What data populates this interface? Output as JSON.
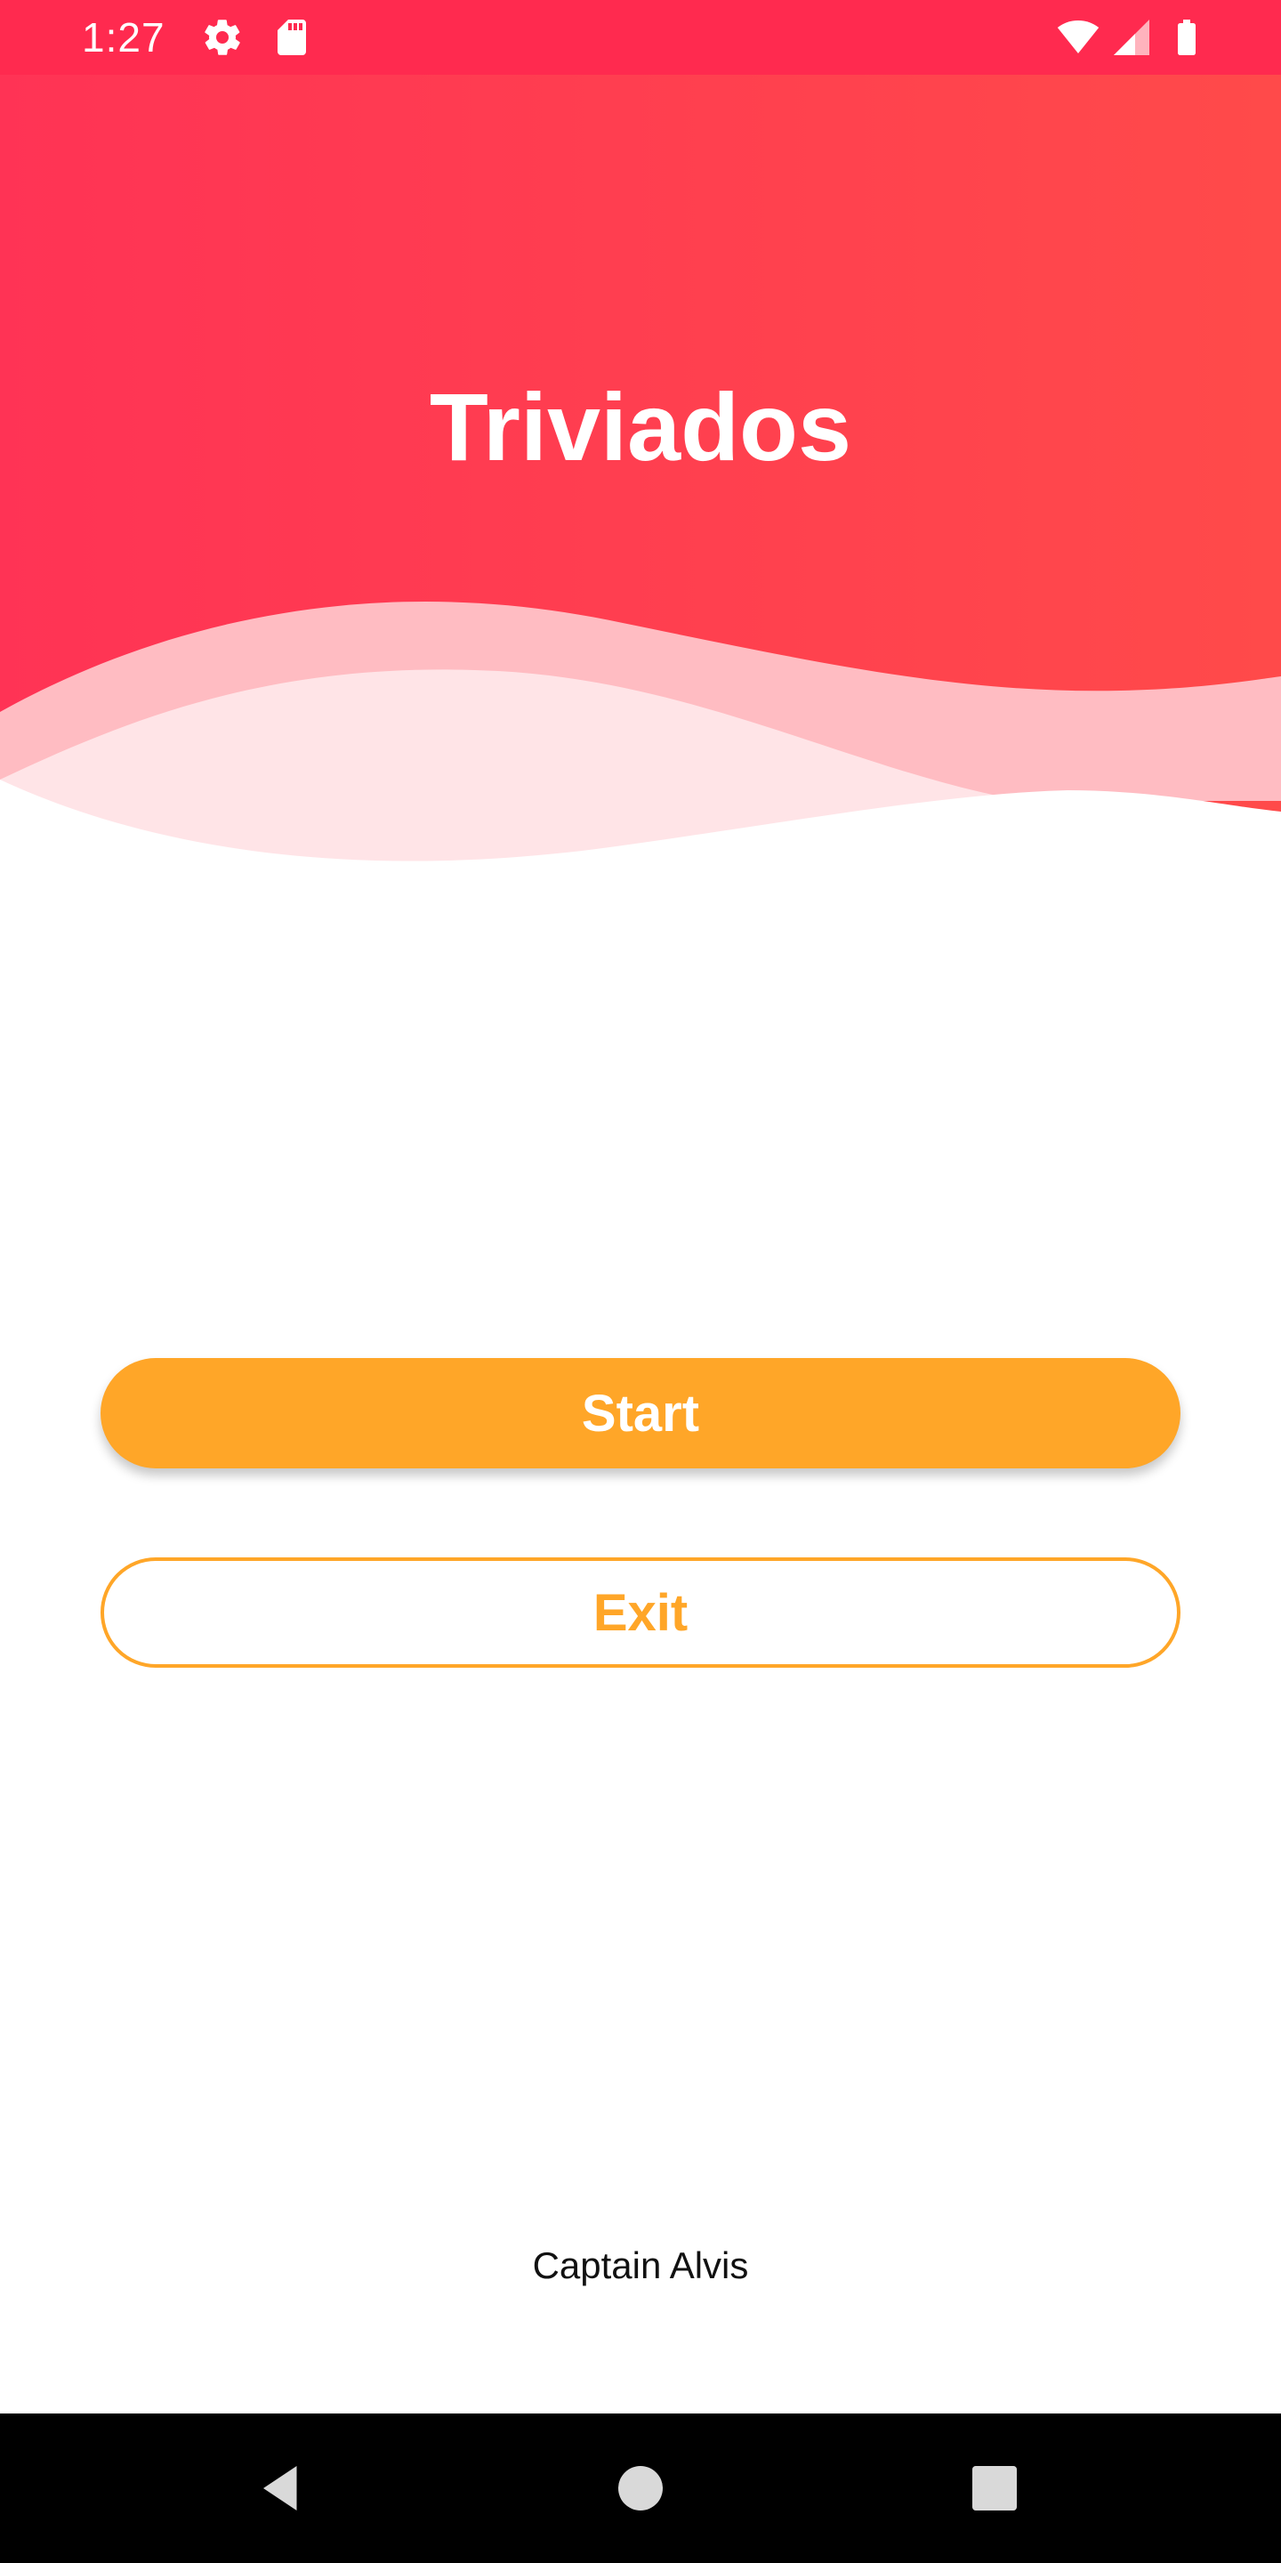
{
  "status_bar": {
    "time": "1:27",
    "left_icons": [
      "settings-icon",
      "sd-card-icon"
    ],
    "right_icons": [
      "wifi-icon",
      "cell-signal-icon",
      "battery-icon"
    ],
    "background_color": "#ff2a4f"
  },
  "header": {
    "title": "Triviados",
    "gradient_start": "#ff3355",
    "gradient_end": "#ff4a4a",
    "wave_colors": [
      "#ffbcc2",
      "#ffe4e7"
    ]
  },
  "actions": {
    "start_label": "Start",
    "exit_label": "Exit",
    "accent_color": "#ffa628"
  },
  "footer": {
    "credit": "Captain Alvis"
  },
  "navigation_bar": {
    "buttons": [
      "back-icon",
      "home-icon",
      "recents-icon"
    ]
  }
}
